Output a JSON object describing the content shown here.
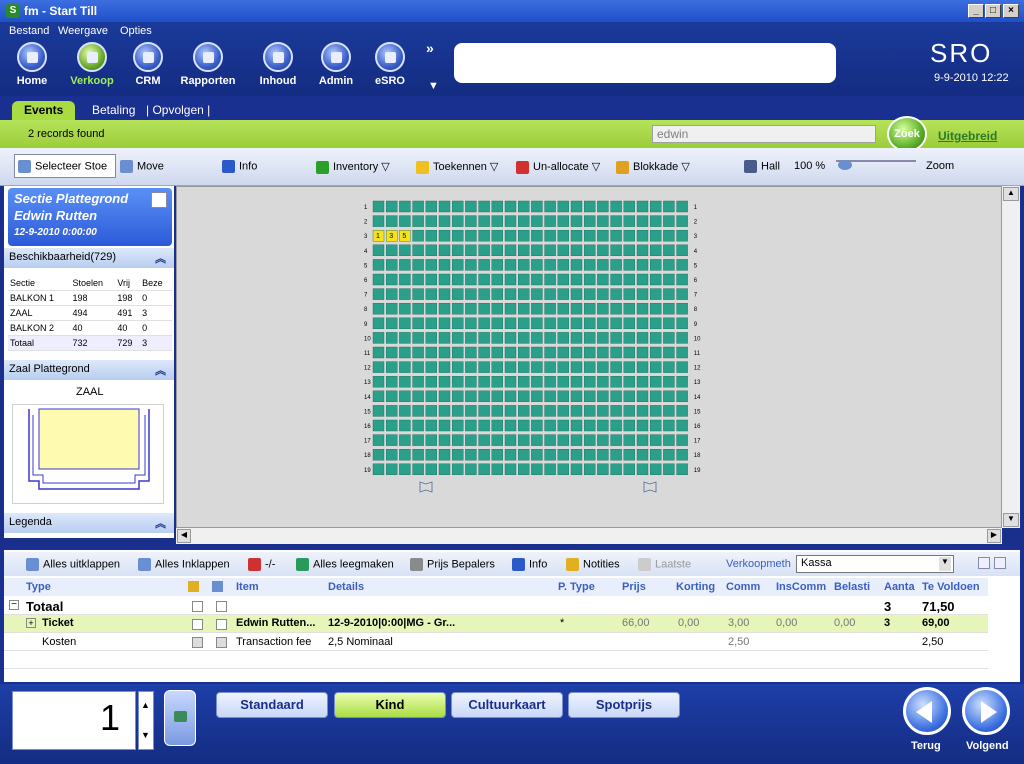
{
  "window": {
    "title": "fm - Start Till"
  },
  "menu": [
    "Bestand",
    "Weergave",
    "Opties"
  ],
  "nav": [
    "Home",
    "Verkoop",
    "CRM",
    "Rapporten",
    "Inhoud",
    "Admin",
    "eSRO"
  ],
  "brand": "SRO",
  "datetime": "9-9-2010 12:22",
  "tabs": {
    "events": "Events",
    "betaling": "Betaling",
    "opvolgen": "| Opvolgen |"
  },
  "status": {
    "records": "2 records found",
    "search_value": "edwin",
    "zoek": "Zoek",
    "uitgebreid": "Uitgebreid"
  },
  "toolbar": {
    "selecteer": "Selecteer Stoe",
    "move": "Move",
    "info": "Info",
    "inventory": "Inventory",
    "toekennen": "Toekennen",
    "unallocate": "Un-allocate",
    "blokkade": "Blokkade",
    "hall": "Hall",
    "zoom_pct": "100 %",
    "zoom": "Zoom"
  },
  "section": {
    "title": "Sectie Plattegrond",
    "customer": "Edwin Rutten",
    "date": "12-9-2010 0:00:00"
  },
  "availability": {
    "header": "Beschikbaarheid(729)",
    "columns": [
      "Sectie",
      "Stoelen",
      "Vrij",
      "Beze"
    ],
    "rows": [
      [
        "BALKON 1",
        "198",
        "198",
        "0"
      ],
      [
        "ZAAL",
        "494",
        "491",
        "3"
      ],
      [
        "BALKON 2",
        "40",
        "40",
        "0"
      ],
      [
        "Totaal",
        "732",
        "729",
        "3"
      ]
    ]
  },
  "zaal_panel": {
    "header": "Zaal Plattegrond",
    "label": "ZAAL"
  },
  "legenda": "Legenda",
  "seatmap": {
    "rows": 19,
    "cols": 24,
    "row_labels": [
      "1",
      "2",
      "3",
      "4",
      "5",
      "6",
      "7",
      "8",
      "9",
      "10",
      "11",
      "12",
      "13",
      "14",
      "15",
      "16",
      "17",
      "18",
      "19"
    ],
    "selected_row": 3,
    "selected_seat_labels": [
      "1",
      "3",
      "5"
    ],
    "colors": {
      "free": "#2aa08a",
      "selected": "#f5e21a",
      "bg": "#d9d9d9"
    }
  },
  "grid_toolbar": {
    "uitklappen": "Alles uitklappen",
    "inklappen": "Alles Inklappen",
    "minus": "-/-",
    "leegmaken": "Alles leegmaken",
    "prijs": "Prijs Bepalers",
    "info": "Info",
    "notities": "Notities",
    "laatste": "Laatste",
    "verkoopmeth_label": "Verkoopmeth",
    "verkoopmeth_value": "Kassa"
  },
  "grid": {
    "headers": [
      "Type",
      "Item",
      "Details",
      "P. Type",
      "Prijs",
      "Korting",
      "Comm",
      "InsComm",
      "Belasti",
      "Aanta",
      "Te Voldoen"
    ],
    "totaal": {
      "type": "Totaal",
      "aantal": "3",
      "te_voldoen": "71,50"
    },
    "ticket": {
      "type": "Ticket",
      "item": "Edwin Rutten...",
      "details": "12-9-2010|0:00|MG - Gr...",
      "ptype": "*",
      "prijs": "66,00",
      "korting": "0,00",
      "comm": "3,00",
      "inscomm": "0,00",
      "belasti": "0,00",
      "aantal": "3",
      "te_voldoen": "69,00"
    },
    "kosten": {
      "type": "Kosten",
      "item": "Transaction fee",
      "details": "2,5 Nominaal",
      "comm": "2,50",
      "te_voldoen": "2,50"
    }
  },
  "bottom": {
    "qty": "1",
    "price_types": [
      "Standaard",
      "Kind",
      "Cultuurkaart",
      "Spotprijs"
    ],
    "terug": "Terug",
    "volgend": "Volgend"
  }
}
